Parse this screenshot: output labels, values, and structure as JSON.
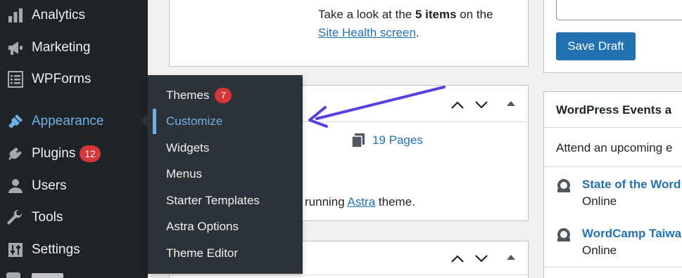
{
  "sidebar": {
    "items": [
      {
        "label": "Analytics",
        "icon": "analytics-bars-icon"
      },
      {
        "label": "Marketing",
        "icon": "megaphone-icon"
      },
      {
        "label": "WPForms",
        "icon": "form-icon"
      },
      {
        "label": "Appearance",
        "icon": "paintbrush-icon",
        "active": true
      },
      {
        "label": "Plugins",
        "icon": "plugin-icon",
        "badge": "12"
      },
      {
        "label": "Users",
        "icon": "user-icon"
      },
      {
        "label": "Tools",
        "icon": "wrench-icon"
      },
      {
        "label": "Settings",
        "icon": "settings-sliders-icon"
      }
    ]
  },
  "flyout": {
    "items": [
      {
        "label": "Themes",
        "badge": "7"
      },
      {
        "label": "Customize",
        "current": true
      },
      {
        "label": "Widgets"
      },
      {
        "label": "Menus"
      },
      {
        "label": "Starter Templates"
      },
      {
        "label": "Astra Options"
      },
      {
        "label": "Theme Editor"
      }
    ]
  },
  "site_health": {
    "text_before": "Take a look at the ",
    "bold": "5 items",
    "text_after": " on the",
    "link": "Site Health screen",
    "period": "."
  },
  "at_a_glance": {
    "pages": "19 Pages",
    "theme_text": "running ",
    "theme_link": "Astra",
    "theme_suffix": " theme."
  },
  "publish": {
    "save_draft_label": "Save Draft"
  },
  "events": {
    "title": "WordPress Events a",
    "intro": "Attend an upcoming e",
    "items": [
      {
        "title": "State of the Word",
        "sub": "Online"
      },
      {
        "title": "WordCamp Taiwa",
        "sub": "Online"
      }
    ]
  },
  "colors": {
    "sidebar_bg": "#1d2327",
    "flyout_bg": "#2c3338",
    "accent": "#72aee6",
    "link": "#2271b1",
    "badge": "#d63638",
    "annotation_arrow": "#5b3fe0"
  }
}
